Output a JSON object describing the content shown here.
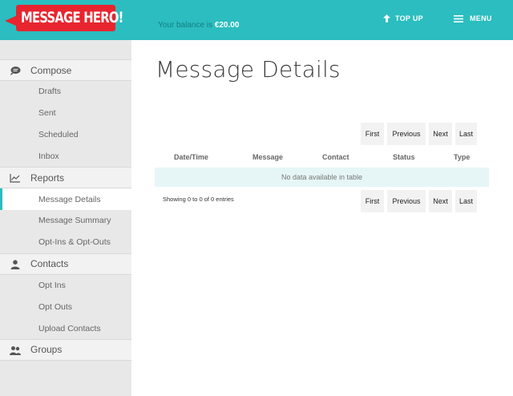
{
  "header": {
    "logo_text": "MESSAGE HERO!",
    "balance_label": "Your balance is ",
    "balance_value": "€20.00",
    "topup_label": "TOP UP",
    "menu_label": "MENU",
    "accent_color": "#2bbdbf",
    "logo_color": "#e8242e"
  },
  "sidebar": {
    "compose": {
      "label": "Compose",
      "icon": "chat-bubble-icon",
      "items": [
        "Drafts",
        "Sent",
        "Scheduled",
        "Inbox"
      ]
    },
    "reports": {
      "label": "Reports",
      "icon": "line-chart-icon",
      "items": [
        "Message Details",
        "Message Summary",
        "Opt-Ins & Opt-Outs"
      ]
    },
    "contacts": {
      "label": "Contacts",
      "icon": "person-icon",
      "items": [
        "Opt Ins",
        "Opt Outs",
        "Upload Contacts"
      ]
    },
    "groups": {
      "label": "Groups",
      "icon": "people-icon"
    },
    "active_item": "Message Details"
  },
  "main": {
    "title": "Message Details",
    "pager": {
      "first": "First",
      "previous": "Previous",
      "next": "Next",
      "last": "Last"
    },
    "columns": [
      "Date/Time",
      "Message",
      "Contact",
      "Status",
      "Type"
    ],
    "empty_text": "No data available in table",
    "showing_text": "Showing 0 to 0 of 0 entries"
  }
}
